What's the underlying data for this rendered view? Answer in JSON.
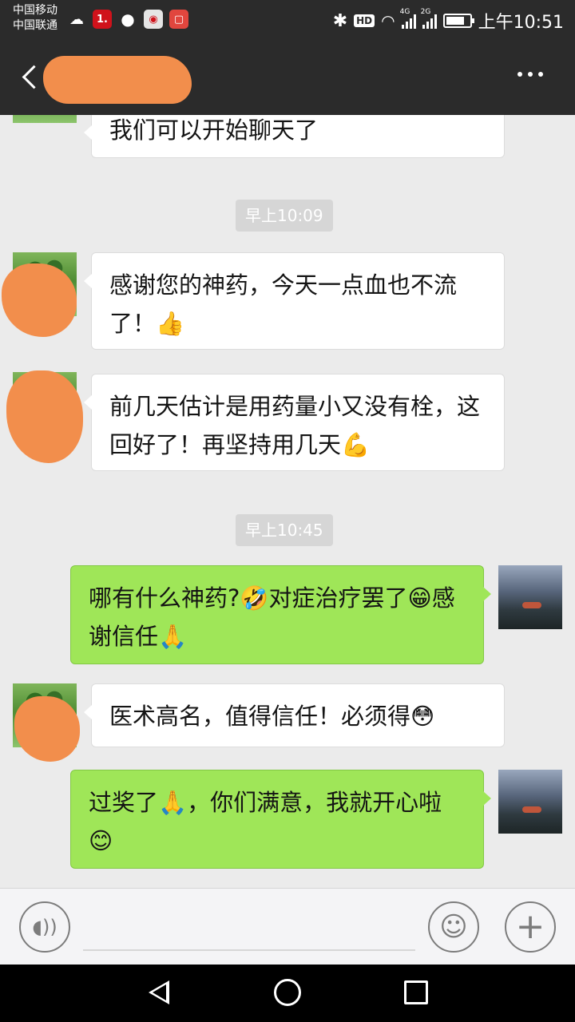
{
  "status_bar": {
    "carrier_1": "中国移动",
    "carrier_2": "中国联通",
    "notif_one": "1.",
    "hd": "HD",
    "net1": "4G",
    "net2": "2G",
    "time": "上午10:51"
  },
  "header": {
    "title_redacted": true,
    "back_icon": "chevron-left-icon",
    "more_icon": "more-dots-icon"
  },
  "messages": [
    {
      "side": "in",
      "text": "我们可以开始聊天了"
    },
    {
      "type": "timestamp",
      "text": "早上10:09"
    },
    {
      "side": "in",
      "text": "感谢您的神药，今天一点血也不流了！👍"
    },
    {
      "side": "in",
      "text": "前几天估计是用药量小又没有栓，这回好了！再坚持用几天💪"
    },
    {
      "type": "timestamp",
      "text": "早上10:45"
    },
    {
      "side": "out",
      "text": "哪有什么神药?🤣对症治疗罢了😁感谢信任🙏"
    },
    {
      "side": "in",
      "text": "医术高名，值得信任！必须得😳"
    },
    {
      "side": "out",
      "text": "过奖了🙏，你们满意，我就开心啦😊"
    }
  ],
  "input_bar": {
    "voice_icon": "voice-icon",
    "emoji_icon": "emoji-icon",
    "plus_icon": "plus-icon"
  },
  "nav_bar": {
    "back_icon": "nav-back-icon",
    "home_icon": "nav-home-icon",
    "recent_icon": "nav-recent-icon"
  },
  "colors": {
    "header_bg": "#2b2b2b",
    "chat_bg": "#ebebeb",
    "out_bubble": "#9fe658",
    "in_bubble": "#ffffff",
    "redaction": "#f28e4c"
  }
}
